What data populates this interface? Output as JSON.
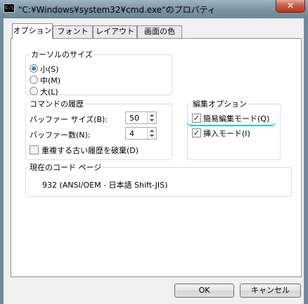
{
  "window": {
    "title": "\"C:¥Windows¥system32¥cmd.exe\"のプロパティ",
    "icon_label": "C:\\.",
    "close_symbol": "✕"
  },
  "tabs": [
    {
      "label": "オプション",
      "active": true
    },
    {
      "label": "フォント",
      "active": false
    },
    {
      "label": "レイアウト",
      "active": false
    },
    {
      "label": "画面の色",
      "active": false
    }
  ],
  "cursor_size": {
    "legend": "カーソルのサイズ",
    "options": [
      "小(S)",
      "中(M)",
      "大(L)"
    ],
    "selected": "小(S)"
  },
  "command_history": {
    "legend": "コマンドの履歴",
    "buffer_size_label": "バッファー サイズ(B):",
    "buffer_size_value": "50",
    "buffer_count_label": "バッファー数(N):",
    "buffer_count_value": "4",
    "discard_duplicates_label": "重複する古い履歴を破棄(D)",
    "discard_duplicates_checked": false
  },
  "edit_options": {
    "legend": "編集オプション",
    "quick_edit_label": "簡易編集モード(Q)",
    "quick_edit_checked": true,
    "insert_mode_label": "挿入モード(I)",
    "insert_mode_checked": true,
    "highlight_color": "#17c9ec"
  },
  "code_page": {
    "legend": "現在のコード ページ",
    "value": "932  (ANSI/OEM - 日本語 Shift-JIS)"
  },
  "buttons": {
    "ok": "OK",
    "cancel": "キャンセル"
  },
  "check_mark": "✓"
}
